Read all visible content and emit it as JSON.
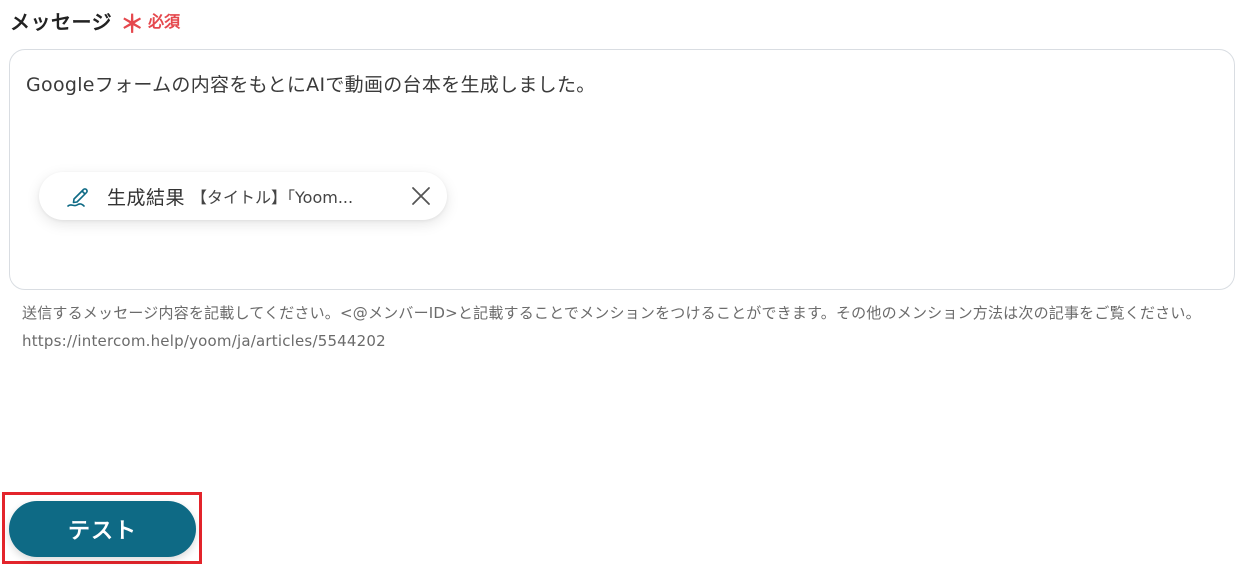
{
  "field": {
    "label": "メッセージ",
    "required_mark": "＊",
    "required_text": "必須"
  },
  "message": {
    "text": "Googleフォームの内容をもとにAIで動画の台本を生成しました。",
    "chip": {
      "icon": "pen-icon",
      "title": "生成結果",
      "detail": "【タイトル】「Yoom...",
      "close_icon": "close-icon"
    }
  },
  "help": {
    "text": "送信するメッセージ内容を記載してください。<@メンバーID>と記載することでメンションをつけることができます。その他のメンション方法は次の記事をご覧ください。https://intercom.help/yoom/ja/articles/5544202"
  },
  "actions": {
    "test_label": "テスト"
  },
  "colors": {
    "required": "#e5484d",
    "primary_button": "#0e6a85",
    "highlight_border": "#e3242b",
    "chip_icon": "#0e6a85"
  }
}
